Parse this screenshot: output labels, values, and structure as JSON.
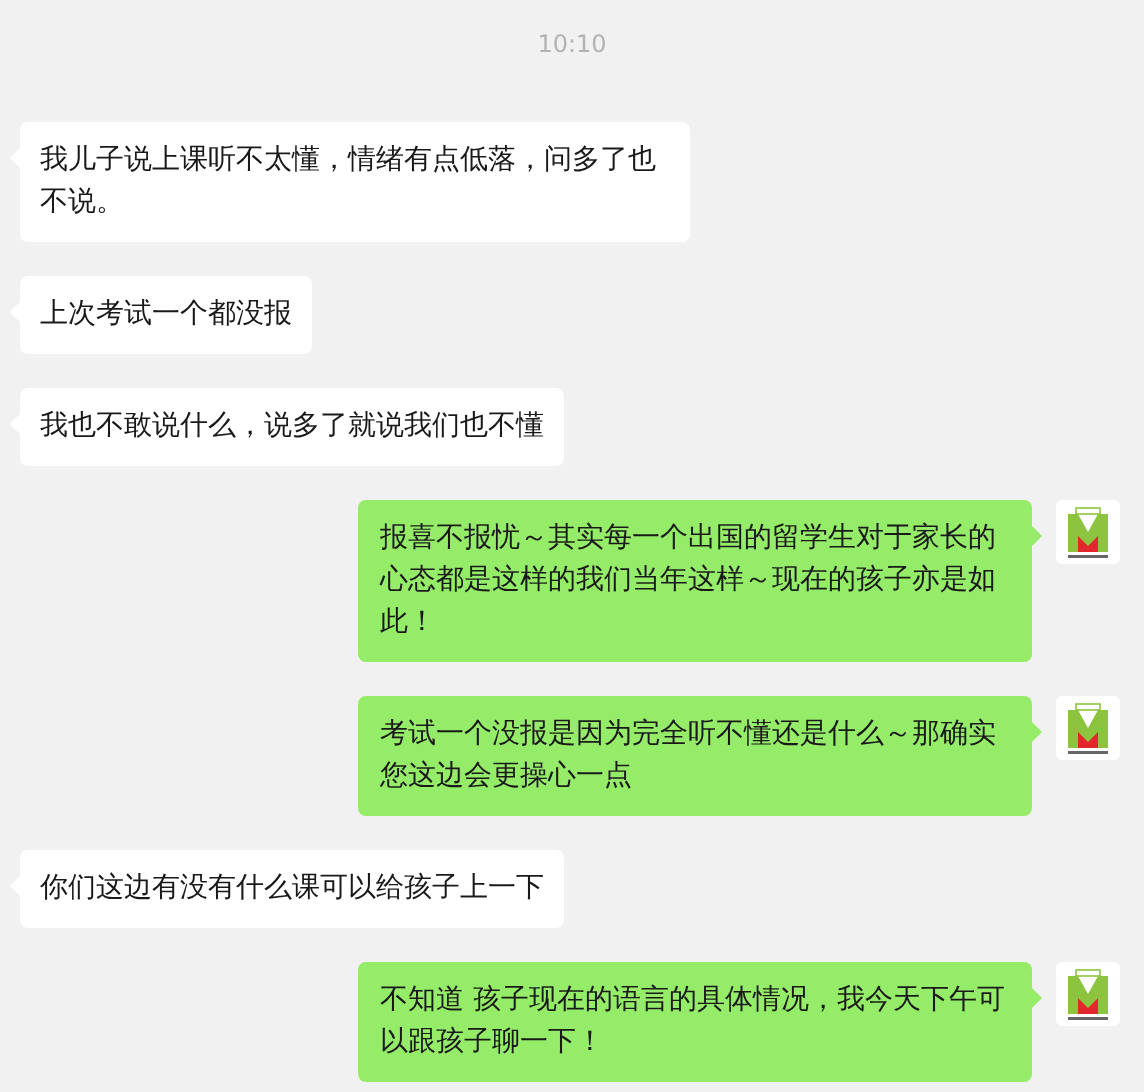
{
  "timestamp": "10:10",
  "messages": [
    {
      "kind": "incoming",
      "text": "我儿子说上课听不太懂，情绪有点低落，问多了也不说。"
    },
    {
      "kind": "incoming",
      "text": "上次考试一个都没报"
    },
    {
      "kind": "incoming",
      "text": "我也不敢说什么，说多了就说我们也不懂"
    },
    {
      "kind": "outgoing",
      "text": "报喜不报忧～其实每一个出国的留学生对于家长的心态都是这样的我们当年这样～现在的孩子亦是如此！"
    },
    {
      "kind": "outgoing",
      "text": "考试一个没报是因为完全听不懂还是什么～那确实您这边会更操心一点"
    },
    {
      "kind": "incoming",
      "text": "你们这边有没有什么课可以给孩子上一下"
    },
    {
      "kind": "outgoing",
      "text": "不知道 孩子现在的语言的具体情况，我今天下午可以跟孩子聊一下！"
    }
  ]
}
